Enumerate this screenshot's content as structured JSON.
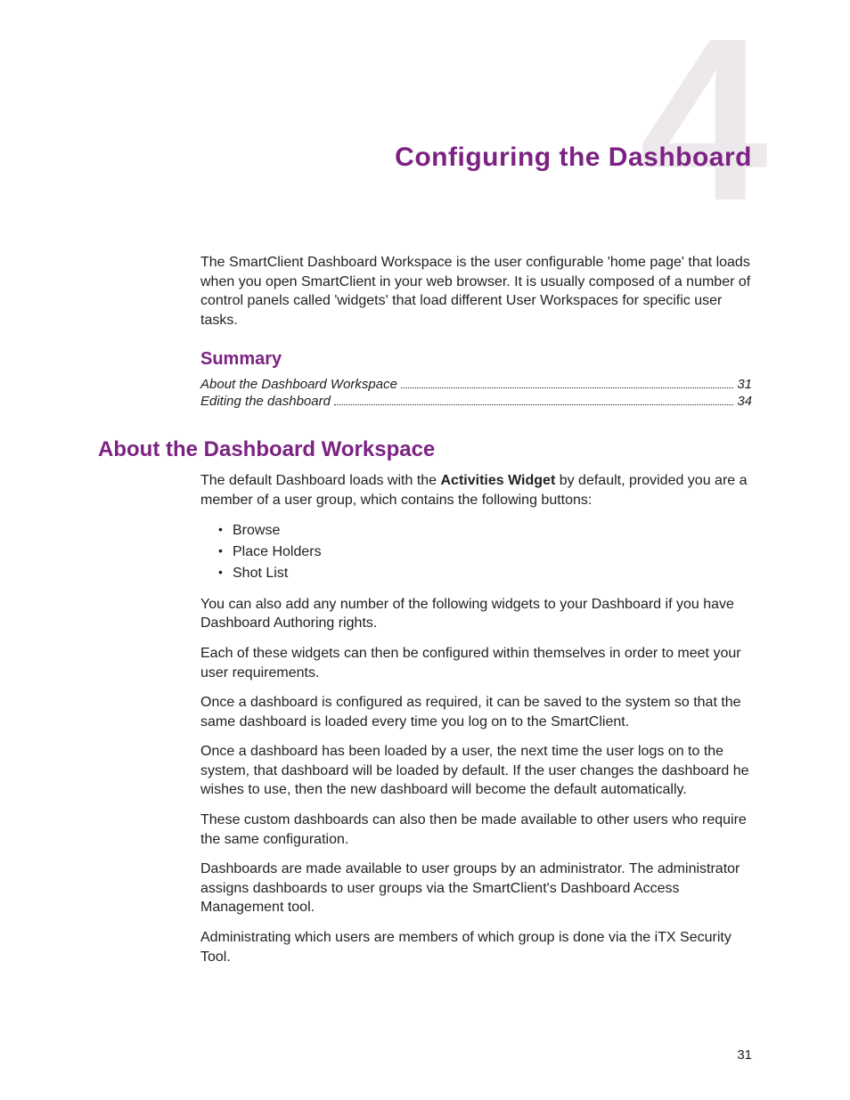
{
  "chapter": {
    "number": "4",
    "title": "Configuring the Dashboard"
  },
  "intro": "The SmartClient Dashboard Workspace is the user configurable 'home page' that loads when you open SmartClient in your web browser. It is usually composed of a number of control panels called 'widgets' that load different User Workspaces for specific user tasks.",
  "summary": {
    "heading": "Summary",
    "items": [
      {
        "label": "About the Dashboard Workspace",
        "page": "31"
      },
      {
        "label": "Editing the dashboard",
        "page": "34"
      }
    ]
  },
  "section": {
    "heading": "About the Dashboard Workspace",
    "lead_pre": "The default Dashboard loads with the ",
    "lead_bold": "Activities Widget",
    "lead_post": " by default, provided you are a member of a user group, which contains the following buttons:",
    "bullets": [
      "Browse",
      "Place Holders",
      "Shot List"
    ],
    "paragraphs": [
      "You can also add any number of the following widgets to your Dashboard if you have Dashboard Authoring rights.",
      "Each of these widgets can then be configured within themselves in order to meet your user requirements.",
      "Once a dashboard is configured as required, it can be saved to the system so that the same dashboard is loaded every time you log on to the SmartClient.",
      "Once a dashboard has been loaded by a user, the next time the user logs on to the system, that dashboard will be loaded by default. If the user changes the dashboard he wishes to use, then the new dashboard will become the default automatically.",
      "These custom dashboards can also then be made available to other users who require the same configuration.",
      "Dashboards are made available to user groups by an administrator. The administrator assigns dashboards to user groups via the SmartClient's Dashboard Access Management tool.",
      "Administrating which users are members of which group is done via the iTX Security Tool."
    ]
  },
  "page_number": "31"
}
